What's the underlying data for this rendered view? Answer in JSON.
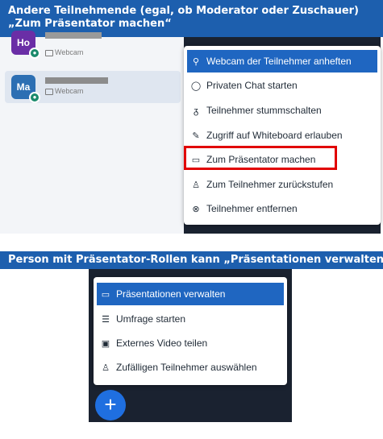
{
  "banner_top": {
    "line1": "Andere Teilnehmende (egal, ob Moderator oder Zuschauer)",
    "line2": "„Zum Präsentator machen“"
  },
  "banner_bottom": {
    "text": "Person mit Präsentator-Rollen kann „Präsentationen verwalten“"
  },
  "users": [
    {
      "initials": "Ho",
      "camera_label": "Webcam"
    },
    {
      "initials": "Ma",
      "camera_label": "Webcam"
    }
  ],
  "participant_menu": {
    "items": [
      {
        "icon": "pin-icon",
        "glyph": "⚲",
        "label": "Webcam der Teilnehmer anheften",
        "active": true
      },
      {
        "icon": "chat-icon",
        "glyph": "◯",
        "label": "Privaten Chat starten"
      },
      {
        "icon": "mute-icon",
        "glyph": "ᵹ",
        "label": "Teilnehmer stummschalten"
      },
      {
        "icon": "pencil-icon",
        "glyph": "✎",
        "label": "Zugriff auf Whiteboard erlauben"
      },
      {
        "icon": "presentation-icon",
        "glyph": "▭",
        "label": "Zum Präsentator machen",
        "highlighted": true
      },
      {
        "icon": "user-icon",
        "glyph": "♙",
        "label": "Zum Teilnehmer zurückstufen"
      },
      {
        "icon": "remove-icon",
        "glyph": "⊗",
        "label": "Teilnehmer entfernen"
      }
    ]
  },
  "presenter_menu": {
    "items": [
      {
        "icon": "presentation-icon",
        "glyph": "▭",
        "label": "Präsentationen verwalten",
        "active": true
      },
      {
        "icon": "poll-icon",
        "glyph": "☰",
        "label": "Umfrage starten"
      },
      {
        "icon": "video-icon",
        "glyph": "▣",
        "label": "Externes Video teilen"
      },
      {
        "icon": "user-icon",
        "glyph": "♙",
        "label": "Zufälligen Teilnehmer auswählen"
      }
    ]
  },
  "fab": {
    "icon": "plus-icon",
    "glyph": "+"
  },
  "colors": {
    "banner": "#1d5fae",
    "active_item": "#1f66c1",
    "highlight": "#e10000",
    "fab": "#1f6fe0"
  }
}
